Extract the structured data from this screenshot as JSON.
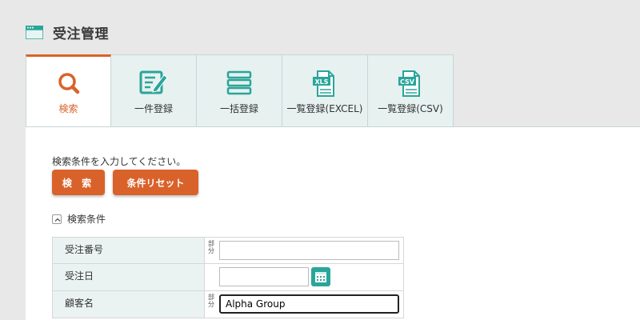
{
  "page": {
    "title": "受注管理",
    "icon": "window-icon",
    "accent": "#d9622b",
    "teal": "#2aa59a"
  },
  "tabs": [
    {
      "label": "検索",
      "icon": "search-icon",
      "active": true
    },
    {
      "label": "一件登録",
      "icon": "edit-form-icon",
      "active": false
    },
    {
      "label": "一括登録",
      "icon": "stack-list-icon",
      "active": false
    },
    {
      "label": "一覧登録(EXCEL)",
      "icon": "xls-file-icon",
      "badge": "XLS",
      "active": false
    },
    {
      "label": "一覧登録(CSV)",
      "icon": "csv-file-icon",
      "badge": "CSV",
      "active": false
    }
  ],
  "search": {
    "instruction": "検索条件を入力してください。",
    "search_button": "検 索",
    "reset_button": "条件リセット",
    "section_label": "検索条件"
  },
  "form": {
    "partial_mark": "部分",
    "rows": [
      {
        "label": "受注番号",
        "value": "",
        "partial": true
      },
      {
        "label": "受注日",
        "value": ""
      },
      {
        "label": "顧客名",
        "value": "Alpha Group",
        "partial": true
      }
    ]
  }
}
